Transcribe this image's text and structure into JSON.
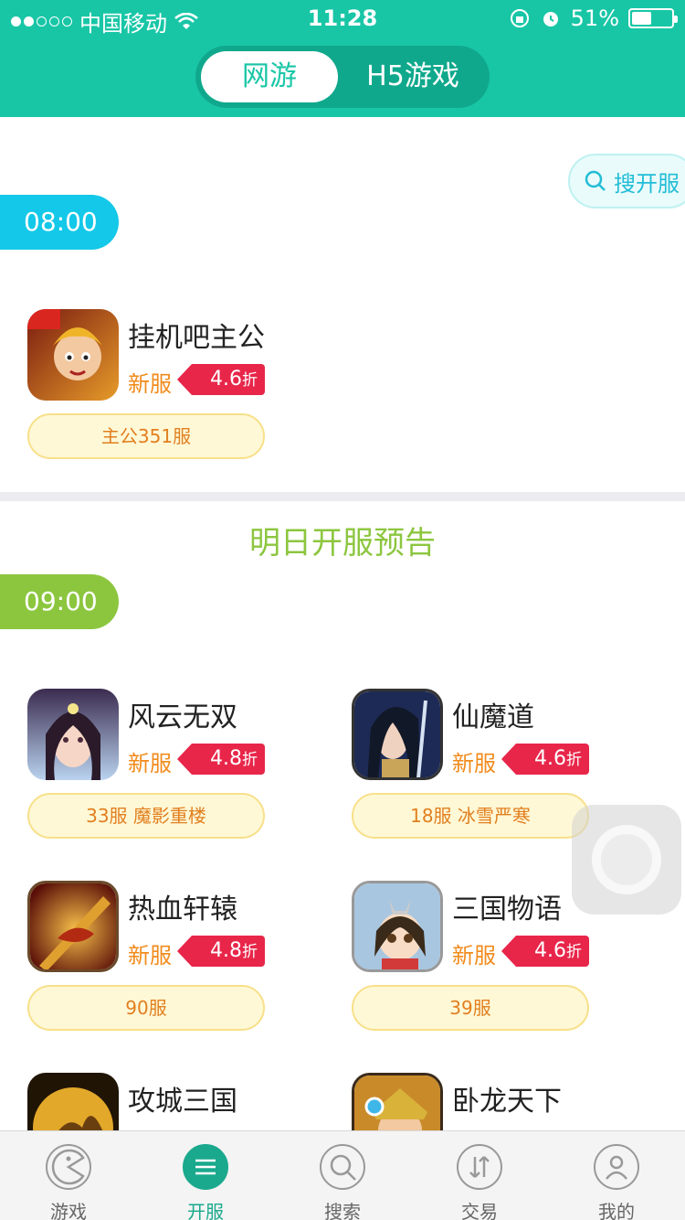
{
  "status_bar": {
    "carrier": "中国移动",
    "time": "11:28",
    "battery": "51%",
    "battery_level": 0.51
  },
  "top_tabs": [
    {
      "label": "网游",
      "active": true
    },
    {
      "label": "H5游戏",
      "active": false
    }
  ],
  "search_button": {
    "label": "搜开服"
  },
  "today": {
    "time": "08:00",
    "games": [
      {
        "name": "挂机吧主公",
        "tag": "新服",
        "discount": "4.6",
        "suffix": "折",
        "server": "主公351服",
        "icon": "game-icon-guajiba"
      }
    ]
  },
  "tomorrow": {
    "title": "明日开服预告",
    "time": "09:00",
    "games": [
      {
        "name": "风云无双",
        "tag": "新服",
        "discount": "4.8",
        "suffix": "折",
        "server": "33服 魔影重楼",
        "icon": "game-icon-fengyun"
      },
      {
        "name": "仙魔道",
        "tag": "新服",
        "discount": "4.6",
        "suffix": "折",
        "server": "18服 冰雪严寒",
        "icon": "game-icon-xianmo"
      },
      {
        "name": "热血轩辕",
        "tag": "新服",
        "discount": "4.8",
        "suffix": "折",
        "server": "90服",
        "icon": "game-icon-rexue"
      },
      {
        "name": "三国物语",
        "tag": "新服",
        "discount": "4.6",
        "suffix": "折",
        "server": "39服",
        "icon": "game-icon-sanguo"
      },
      {
        "name": "攻城三国",
        "tag": "",
        "discount": "",
        "suffix": "",
        "server": "",
        "icon": "game-icon-gongcheng"
      },
      {
        "name": "卧龙天下",
        "tag": "",
        "discount": "",
        "suffix": "",
        "server": "",
        "icon": "game-icon-wolong"
      }
    ]
  },
  "tabbar": [
    {
      "label": "游戏",
      "icon": "pacman-icon",
      "active": false
    },
    {
      "label": "开服",
      "icon": "menu-icon",
      "active": true
    },
    {
      "label": "搜索",
      "icon": "search-icon",
      "active": false
    },
    {
      "label": "交易",
      "icon": "transfer-icon",
      "active": false
    },
    {
      "label": "我的",
      "icon": "user-icon",
      "active": false
    }
  ],
  "colors": {
    "header": "#18c6a6",
    "today_badge": "#13c8e8",
    "tomorrow_badge": "#8cc63f",
    "discount": "#e8264a",
    "new_tag": "#f18b1c"
  }
}
